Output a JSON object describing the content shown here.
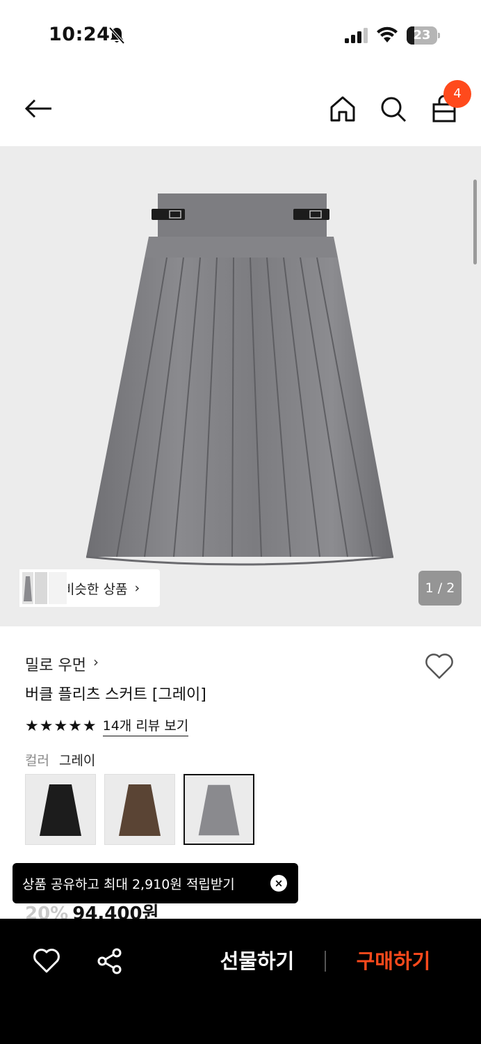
{
  "status_bar": {
    "time": "10:24",
    "battery": "23",
    "icons": [
      "bell-off-icon",
      "cellular-signal-icon",
      "wifi-icon",
      "battery-icon"
    ]
  },
  "header": {
    "icons": [
      "back-arrow-icon",
      "home-icon",
      "search-icon",
      "shopping-bag-icon"
    ],
    "cart_count": "4"
  },
  "gallery": {
    "similar_label": "비슷한 상품",
    "similar_chevron": "›",
    "page_indicator": "1 / 2"
  },
  "product": {
    "brand": "밀로 우먼",
    "brand_chevron": "›",
    "title": "버클 플리츠 스커트 [그레이]",
    "stars": "★★★★★",
    "review_link": "14개 리뷰 보기",
    "color_label": "컬러",
    "color_value": "그레이",
    "swatches": [
      {
        "name": "black",
        "color": "#1c1c1c"
      },
      {
        "name": "brown",
        "color": "#5a4434"
      },
      {
        "name": "gray",
        "color": "#8a8a8e",
        "selected": true
      }
    ],
    "discount": "20%",
    "price": "94,400원"
  },
  "toast": {
    "text": "상품 공유하고 최대 2,910원 적립받기",
    "close": "×"
  },
  "bottom_bar": {
    "gift_label": "선물하기",
    "buy_label": "구매하기",
    "accent_color": "#ff4a1c"
  }
}
